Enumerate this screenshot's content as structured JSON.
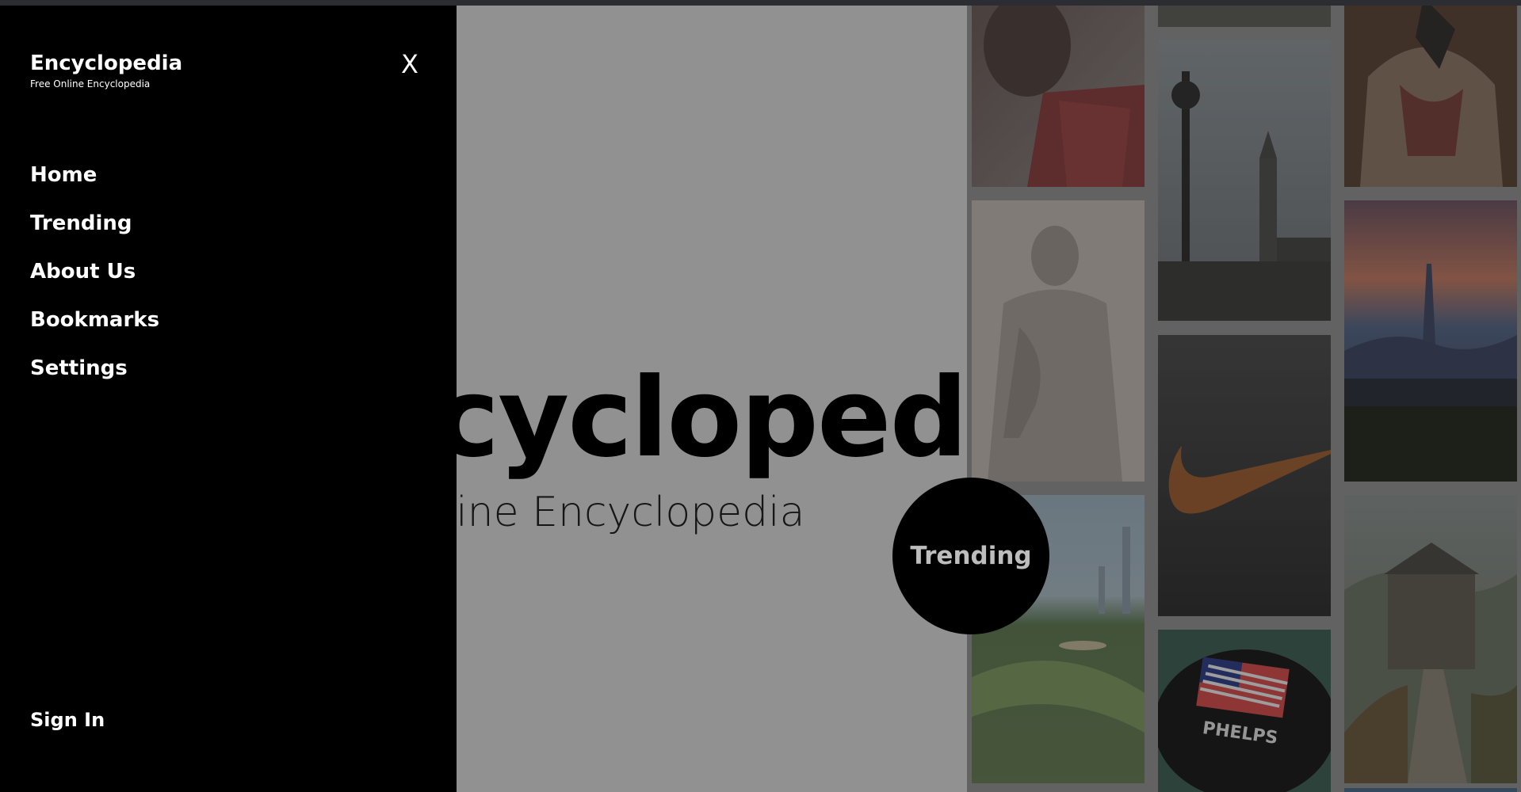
{
  "drawer": {
    "brand_title": "Encyclopedia",
    "brand_subtitle": "Free Online Encyclopedia",
    "close_label": "X",
    "nav_items": [
      {
        "label": "Home"
      },
      {
        "label": "Trending"
      },
      {
        "label": "About Us"
      },
      {
        "label": "Bookmarks"
      },
      {
        "label": "Settings"
      }
    ],
    "sign_in_label": "Sign In"
  },
  "hero": {
    "title": "Encyclopedia",
    "subtitle": "Free Online Encyclopedia"
  },
  "trending_button": {
    "label": "Trending"
  },
  "gallery": {
    "images": [
      {
        "name": "athlete-image"
      },
      {
        "name": "statue-image"
      },
      {
        "name": "golf-course-image"
      },
      {
        "name": "london-big-ben-image"
      },
      {
        "name": "nike-logo-image"
      },
      {
        "name": "phelps-swim-cap-image"
      },
      {
        "name": "painting-image"
      },
      {
        "name": "city-skyline-image"
      },
      {
        "name": "great-wall-image"
      }
    ]
  },
  "colors": {
    "drawer_background": "#000000",
    "page_background": "#919191",
    "trending_circle": "#000000",
    "nike_swoosh": "#c06a2e"
  }
}
